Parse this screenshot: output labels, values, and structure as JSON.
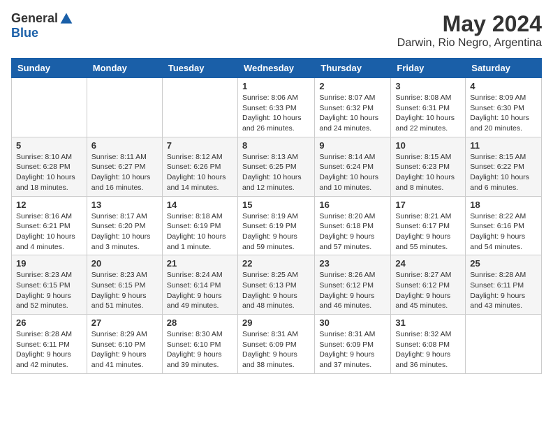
{
  "header": {
    "logo_general": "General",
    "logo_blue": "Blue",
    "month_year": "May 2024",
    "location": "Darwin, Rio Negro, Argentina"
  },
  "days_of_week": [
    "Sunday",
    "Monday",
    "Tuesday",
    "Wednesday",
    "Thursday",
    "Friday",
    "Saturday"
  ],
  "weeks": [
    [
      {
        "day": "",
        "info": ""
      },
      {
        "day": "",
        "info": ""
      },
      {
        "day": "",
        "info": ""
      },
      {
        "day": "1",
        "info": "Sunrise: 8:06 AM\nSunset: 6:33 PM\nDaylight: 10 hours\nand 26 minutes."
      },
      {
        "day": "2",
        "info": "Sunrise: 8:07 AM\nSunset: 6:32 PM\nDaylight: 10 hours\nand 24 minutes."
      },
      {
        "day": "3",
        "info": "Sunrise: 8:08 AM\nSunset: 6:31 PM\nDaylight: 10 hours\nand 22 minutes."
      },
      {
        "day": "4",
        "info": "Sunrise: 8:09 AM\nSunset: 6:30 PM\nDaylight: 10 hours\nand 20 minutes."
      }
    ],
    [
      {
        "day": "5",
        "info": "Sunrise: 8:10 AM\nSunset: 6:28 PM\nDaylight: 10 hours\nand 18 minutes."
      },
      {
        "day": "6",
        "info": "Sunrise: 8:11 AM\nSunset: 6:27 PM\nDaylight: 10 hours\nand 16 minutes."
      },
      {
        "day": "7",
        "info": "Sunrise: 8:12 AM\nSunset: 6:26 PM\nDaylight: 10 hours\nand 14 minutes."
      },
      {
        "day": "8",
        "info": "Sunrise: 8:13 AM\nSunset: 6:25 PM\nDaylight: 10 hours\nand 12 minutes."
      },
      {
        "day": "9",
        "info": "Sunrise: 8:14 AM\nSunset: 6:24 PM\nDaylight: 10 hours\nand 10 minutes."
      },
      {
        "day": "10",
        "info": "Sunrise: 8:15 AM\nSunset: 6:23 PM\nDaylight: 10 hours\nand 8 minutes."
      },
      {
        "day": "11",
        "info": "Sunrise: 8:15 AM\nSunset: 6:22 PM\nDaylight: 10 hours\nand 6 minutes."
      }
    ],
    [
      {
        "day": "12",
        "info": "Sunrise: 8:16 AM\nSunset: 6:21 PM\nDaylight: 10 hours\nand 4 minutes."
      },
      {
        "day": "13",
        "info": "Sunrise: 8:17 AM\nSunset: 6:20 PM\nDaylight: 10 hours\nand 3 minutes."
      },
      {
        "day": "14",
        "info": "Sunrise: 8:18 AM\nSunset: 6:19 PM\nDaylight: 10 hours\nand 1 minute."
      },
      {
        "day": "15",
        "info": "Sunrise: 8:19 AM\nSunset: 6:19 PM\nDaylight: 9 hours\nand 59 minutes."
      },
      {
        "day": "16",
        "info": "Sunrise: 8:20 AM\nSunset: 6:18 PM\nDaylight: 9 hours\nand 57 minutes."
      },
      {
        "day": "17",
        "info": "Sunrise: 8:21 AM\nSunset: 6:17 PM\nDaylight: 9 hours\nand 55 minutes."
      },
      {
        "day": "18",
        "info": "Sunrise: 8:22 AM\nSunset: 6:16 PM\nDaylight: 9 hours\nand 54 minutes."
      }
    ],
    [
      {
        "day": "19",
        "info": "Sunrise: 8:23 AM\nSunset: 6:15 PM\nDaylight: 9 hours\nand 52 minutes."
      },
      {
        "day": "20",
        "info": "Sunrise: 8:23 AM\nSunset: 6:15 PM\nDaylight: 9 hours\nand 51 minutes."
      },
      {
        "day": "21",
        "info": "Sunrise: 8:24 AM\nSunset: 6:14 PM\nDaylight: 9 hours\nand 49 minutes."
      },
      {
        "day": "22",
        "info": "Sunrise: 8:25 AM\nSunset: 6:13 PM\nDaylight: 9 hours\nand 48 minutes."
      },
      {
        "day": "23",
        "info": "Sunrise: 8:26 AM\nSunset: 6:12 PM\nDaylight: 9 hours\nand 46 minutes."
      },
      {
        "day": "24",
        "info": "Sunrise: 8:27 AM\nSunset: 6:12 PM\nDaylight: 9 hours\nand 45 minutes."
      },
      {
        "day": "25",
        "info": "Sunrise: 8:28 AM\nSunset: 6:11 PM\nDaylight: 9 hours\nand 43 minutes."
      }
    ],
    [
      {
        "day": "26",
        "info": "Sunrise: 8:28 AM\nSunset: 6:11 PM\nDaylight: 9 hours\nand 42 minutes."
      },
      {
        "day": "27",
        "info": "Sunrise: 8:29 AM\nSunset: 6:10 PM\nDaylight: 9 hours\nand 41 minutes."
      },
      {
        "day": "28",
        "info": "Sunrise: 8:30 AM\nSunset: 6:10 PM\nDaylight: 9 hours\nand 39 minutes."
      },
      {
        "day": "29",
        "info": "Sunrise: 8:31 AM\nSunset: 6:09 PM\nDaylight: 9 hours\nand 38 minutes."
      },
      {
        "day": "30",
        "info": "Sunrise: 8:31 AM\nSunset: 6:09 PM\nDaylight: 9 hours\nand 37 minutes."
      },
      {
        "day": "31",
        "info": "Sunrise: 8:32 AM\nSunset: 6:08 PM\nDaylight: 9 hours\nand 36 minutes."
      },
      {
        "day": "",
        "info": ""
      }
    ]
  ]
}
